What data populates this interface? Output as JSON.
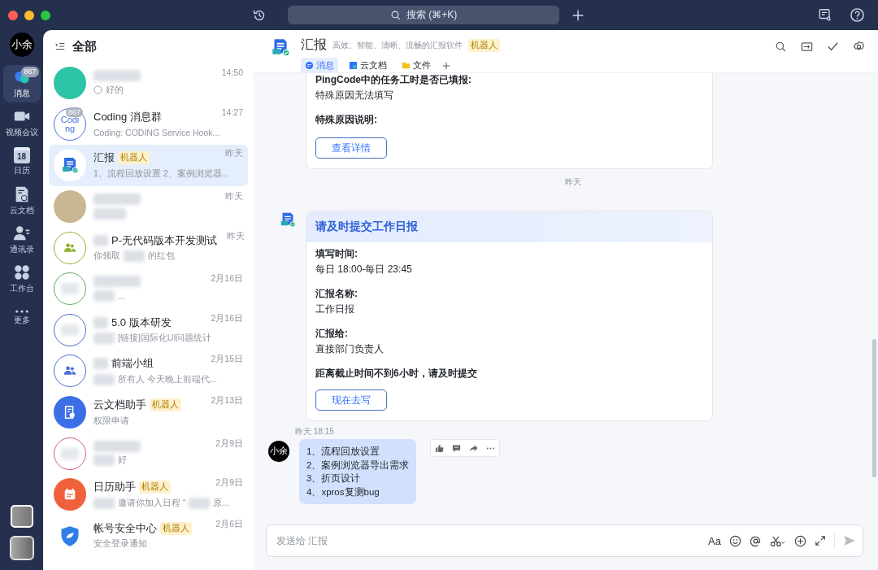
{
  "titlebar": {
    "search_label": "搜索 (⌘+K)"
  },
  "rail": {
    "user_avatar": "小余",
    "items": [
      {
        "kind": "chat",
        "label": "消息",
        "selected": true,
        "badge": "867"
      },
      {
        "kind": "video",
        "label": "视频会议",
        "selected": false
      },
      {
        "kind": "calendar",
        "label": "日历",
        "date": "18",
        "selected": false
      },
      {
        "kind": "doc",
        "label": "云文档",
        "selected": false
      },
      {
        "kind": "contacts",
        "label": "通讯录",
        "selected": false
      },
      {
        "kind": "apps",
        "label": "工作台",
        "selected": false
      },
      {
        "kind": "more",
        "label": "更多",
        "selected": false
      }
    ]
  },
  "list": {
    "title": "全部",
    "conversations": [
      {
        "color": "#2ec4a6",
        "name": [
          {
            "kind": "blur"
          }
        ],
        "preview": [
          {
            "kind": "circle"
          },
          {
            "kind": "text",
            "text": "好的"
          }
        ],
        "time": "14:50",
        "selected": false
      },
      {
        "kind": "text",
        "avatar_text": "Coding",
        "unread": "867",
        "color": "#4a6fd8",
        "name": [
          {
            "kind": "text",
            "text": "Coding 消息群"
          }
        ],
        "preview": [
          {
            "kind": "text",
            "text": "Coding: CODING Service Hook..."
          }
        ],
        "time": "14:27",
        "selected": false
      },
      {
        "kind": "report",
        "color": "#ffffff",
        "name": [
          {
            "kind": "text",
            "text": "汇报"
          }
        ],
        "tag": "机器人",
        "preview": [
          {
            "kind": "text",
            "text": "1、流程回放设置 2、案例浏览器..."
          }
        ],
        "time": "昨天",
        "selected": true
      },
      {
        "color": "#c9b793",
        "name": [
          {
            "kind": "blur"
          }
        ],
        "preview": [
          {
            "kind": "blur"
          }
        ],
        "time": "昨天",
        "selected": false
      },
      {
        "kind": "group",
        "color": "#8fb32a",
        "name": [
          {
            "kind": "blur"
          },
          {
            "kind": "text",
            "text": "P-无代码版本开发测试"
          }
        ],
        "preview": [
          {
            "kind": "text",
            "text": "你领取"
          },
          {
            "kind": "blur"
          },
          {
            "kind": "text",
            "text": "的红包"
          }
        ],
        "time": "昨天",
        "selected": false
      },
      {
        "kind": "blank",
        "color": "#5fae5f",
        "name": [
          {
            "kind": "blur"
          }
        ],
        "preview": [
          {
            "kind": "blur"
          },
          {
            "kind": "text",
            "text": "..."
          }
        ],
        "time": "2月16日",
        "selected": false
      },
      {
        "kind": "blank",
        "color": "#4a6fd8",
        "name": [
          {
            "kind": "blur"
          },
          {
            "kind": "text",
            "text": "5.0 版本研发"
          }
        ],
        "preview": [
          {
            "kind": "blur"
          },
          {
            "kind": "text",
            "text": "[链接]国际化UI问题统计"
          }
        ],
        "time": "2月16日",
        "selected": false
      },
      {
        "kind": "group",
        "color": "#4a6fd8",
        "name": [
          {
            "kind": "blur"
          },
          {
            "kind": "text",
            "text": "前端小组"
          }
        ],
        "preview": [
          {
            "kind": "blur"
          },
          {
            "kind": "text",
            "text": "所有人 今天晚上前端代..."
          }
        ],
        "time": "2月15日",
        "selected": false
      },
      {
        "kind": "doc",
        "color": "#3c6ee8",
        "name": [
          {
            "kind": "text",
            "text": "云文档助手"
          }
        ],
        "tag": "机器人",
        "preview": [
          {
            "kind": "text",
            "text": "权限申请"
          }
        ],
        "time": "2月13日",
        "selected": false
      },
      {
        "kind": "blank",
        "color": "#d45b8a",
        "name": [
          {
            "kind": "blur"
          }
        ],
        "preview": [
          {
            "kind": "blur"
          },
          {
            "kind": "text",
            "text": "好"
          }
        ],
        "time": "2月9日",
        "selected": false
      },
      {
        "kind": "calendar",
        "color": "#f0603a",
        "name": [
          {
            "kind": "text",
            "text": "日历助手"
          }
        ],
        "tag": "机器人",
        "preview": [
          {
            "kind": "blur"
          },
          {
            "kind": "text",
            "text": "邀请你加入日程 “"
          },
          {
            "kind": "blur"
          },
          {
            "kind": "text",
            "text": "原..."
          }
        ],
        "time": "2月9日",
        "selected": false
      },
      {
        "kind": "shield",
        "color": "#2f7de8",
        "name": [
          {
            "kind": "text",
            "text": "帐号安全中心"
          }
        ],
        "tag": "机器人",
        "preview": [
          {
            "kind": "text",
            "text": "安全登录通知"
          }
        ],
        "time": "2月6日",
        "selected": false
      }
    ]
  },
  "chat": {
    "title": "汇报",
    "subtitle": "高效、智能、清晰、流畅的汇报软件",
    "tag": "机器人",
    "tabs": [
      {
        "kind": "chat",
        "label": "消息",
        "selected": true
      },
      {
        "kind": "doc",
        "label": "云文档",
        "selected": false
      },
      {
        "kind": "folder",
        "label": "文件",
        "selected": false
      }
    ],
    "messages": [
      {
        "kind": "card",
        "fields": [
          {
            "label": "PingCode中的任务工时是否已填报:",
            "value": "特殊原因无法填写"
          },
          {
            "label": "特殊原因说明:"
          }
        ],
        "button": "查看详情"
      },
      {
        "kind": "divider",
        "text": "昨天"
      },
      {
        "kind": "card",
        "title": "请及时提交工作日报",
        "fields": [
          {
            "label": "填写时间:",
            "value": "每日 18:00-每日 23:45"
          },
          {
            "label": "汇报名称:",
            "value": "工作日报"
          },
          {
            "label": "汇报给:",
            "value": "直接部门负责人"
          }
        ],
        "notice": "距离截止时间不到6小时，请及时提交",
        "button": "现在去写"
      },
      {
        "kind": "time",
        "text": "昨天 18:15"
      },
      {
        "kind": "bubble",
        "sender": "小余",
        "lines": [
          "1、流程回放设置",
          "2、案例浏览器导出需求",
          "3、折页设计",
          "4、xpros复测bug"
        ]
      }
    ],
    "input": {
      "placeholder": "发送给 汇报",
      "format_label": "Aa"
    }
  }
}
